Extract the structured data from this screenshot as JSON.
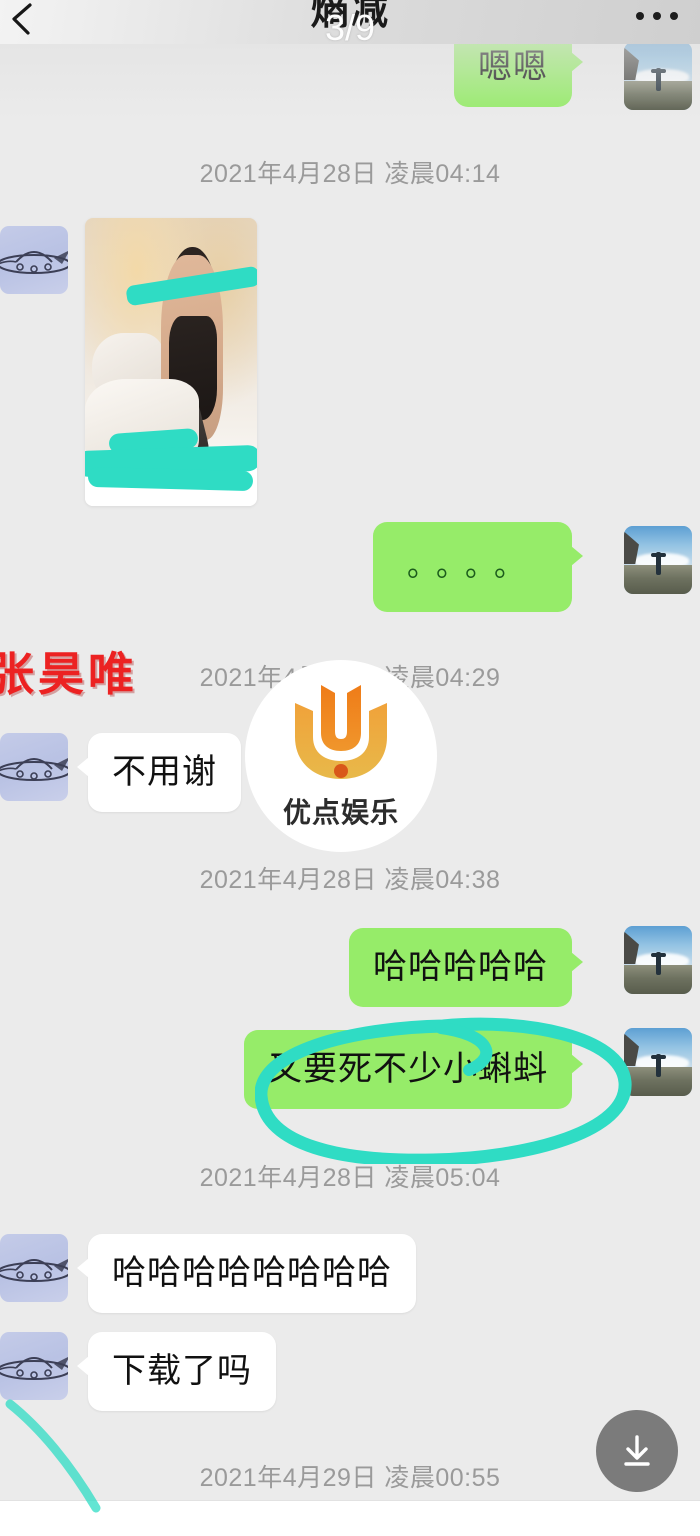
{
  "header": {
    "back_icon": "chevron-left-icon",
    "title": "熵减",
    "page_indicator": "3/9",
    "more_icon": "more-horizontal-icon"
  },
  "annotations": {
    "red_name": "张昊唯",
    "watermark_text": "优点娱乐",
    "watermark_mark": "letter-u-logo",
    "highlight_color": "#2fdcc4",
    "red_color": "#ec2222"
  },
  "colors": {
    "outgoing_bubble": "#96ec69",
    "incoming_bubble": "#ffffff",
    "chat_background": "#ebebeb",
    "timestamp_text": "#9a9a9a",
    "fab_background": "#7b7b7b"
  },
  "timestamps": {
    "t1": "2021年4月28日 凌晨04:14",
    "t2": "2021年4月28日 凌晨04:29",
    "t3": "2021年4月28日 凌晨04:38",
    "t4": "2021年4月28日 凌晨05:04",
    "t5": "2021年4月29日 凌晨00:55"
  },
  "messages": {
    "m0_outgoing_text": "嗯嗯",
    "m1_image_alt": "censored-photo",
    "m2_outgoing_dots": "。。。。",
    "m3_incoming_text": "不用谢",
    "m4_outgoing_text": "哈哈哈哈哈",
    "m5_outgoing_text": "又要死不少小蝌蚪",
    "m6_incoming_text": "哈哈哈哈哈哈哈哈",
    "m7_incoming_text": "下载了吗"
  },
  "avatars": {
    "left_icon": "ufo-avatar",
    "right_icon": "beach-photo-avatar"
  },
  "fab": {
    "icon": "download-icon"
  }
}
